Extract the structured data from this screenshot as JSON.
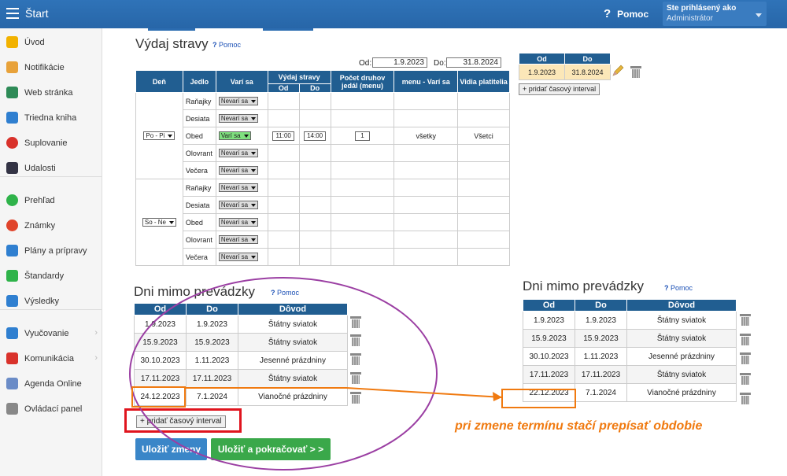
{
  "topbar": {
    "title": "Štart",
    "help": "Pomoc",
    "user_line1": "Ste prihlásený ako",
    "user_line2": "Administrátor"
  },
  "sidebar": {
    "items": [
      {
        "label": "Úvod",
        "icon": "star-icon",
        "color": "#f2b200"
      },
      {
        "label": "Notifikácie",
        "icon": "envelope-icon",
        "color": "#e8a23a"
      },
      {
        "label": "Web stránka",
        "icon": "home-icon",
        "color": "#2e8b57"
      },
      {
        "label": "Triedna kniha",
        "icon": "book-icon",
        "color": "#2f7fd0"
      },
      {
        "label": "Suplovanie",
        "icon": "person-icon",
        "color": "#d9322b"
      },
      {
        "label": "Udalosti",
        "icon": "calendar-icon",
        "color": "#334"
      },
      {
        "label": "Prehľad",
        "icon": "check-circle-icon",
        "color": "#2fb34a"
      },
      {
        "label": "Známky",
        "icon": "grade-icon",
        "color": "#e0442b"
      },
      {
        "label": "Plány a prípravy",
        "icon": "briefcase-icon",
        "color": "#2f7fd0"
      },
      {
        "label": "Štandardy",
        "icon": "shield-icon",
        "color": "#2fb34a"
      },
      {
        "label": "Výsledky",
        "icon": "bar-chart-icon",
        "color": "#2f7fd0"
      },
      {
        "label": "Vyučovanie",
        "icon": "book-open-icon",
        "color": "#2f7fd0"
      },
      {
        "label": "Komunikácia",
        "icon": "chat-icon",
        "color": "#d9322b"
      },
      {
        "label": "Agenda Online",
        "icon": "pen-icon",
        "color": "#6b8cc7"
      },
      {
        "label": "Ovládací panel",
        "icon": "gear-icon",
        "color": "#888"
      }
    ]
  },
  "vydaj": {
    "title": "Výdaj stravy",
    "help": "Pomoc",
    "od_label": "Od:",
    "od_value": "1.9.2023",
    "do_label": "Do:",
    "do_value": "31.8.2024",
    "headers": {
      "den": "Deň",
      "jedlo": "Jedlo",
      "vari": "Varí sa",
      "vydaj": "Výdaj stravy",
      "od": "Od",
      "do": "Do",
      "pocet": "Počet druhov jedál (menu)",
      "menu": "menu - Varí sa",
      "vidia": "Vidia platitelia"
    },
    "group1": {
      "day": "Po - Pi",
      "meals": [
        {
          "name": "Raňajky",
          "status": "Nevarí sa"
        },
        {
          "name": "Desiata",
          "status": "Nevarí sa"
        },
        {
          "name": "Obed",
          "status": "Varí sa",
          "od": "11:00",
          "do": "14:00",
          "pocet": "1",
          "menu": "všetky",
          "vidia": "Všetci"
        },
        {
          "name": "Olovrant",
          "status": "Nevarí sa"
        },
        {
          "name": "Večera",
          "status": "Nevarí sa"
        }
      ]
    },
    "group2": {
      "day": "So - Ne",
      "meals": [
        {
          "name": "Raňajky",
          "status": "Nevarí sa"
        },
        {
          "name": "Desiata",
          "status": "Nevarí sa"
        },
        {
          "name": "Obed",
          "status": "Nevarí sa"
        },
        {
          "name": "Olovrant",
          "status": "Nevarí sa"
        },
        {
          "name": "Večera",
          "status": "Nevarí sa"
        }
      ]
    }
  },
  "interval": {
    "od_header": "Od",
    "do_header": "Do",
    "od": "1.9.2023",
    "do": "31.8.2024",
    "add": "+ pridať časový interval"
  },
  "dni_left": {
    "title": "Dni mimo prevádzky",
    "help": "Pomoc",
    "headers": [
      "Od",
      "Do",
      "Dôvod"
    ],
    "rows": [
      [
        "1.9.2023",
        "1.9.2023",
        "Štátny sviatok"
      ],
      [
        "15.9.2023",
        "15.9.2023",
        "Štátny sviatok"
      ],
      [
        "30.10.2023",
        "1.11.2023",
        "Jesenné prázdniny"
      ],
      [
        "17.11.2023",
        "17.11.2023",
        "Štátny sviatok"
      ],
      [
        "24.12.2023",
        "7.1.2024",
        "Vianočné prázdniny"
      ]
    ],
    "add": "+ pridať časový interval",
    "save": "Uložiť zmeny",
    "save_continue": "Uložiť a pokračovať > >"
  },
  "dni_right": {
    "title": "Dni mimo prevádzky",
    "help": "Pomoc",
    "headers": [
      "Od",
      "Do",
      "Dôvod"
    ],
    "rows": [
      [
        "1.9.2023",
        "1.9.2023",
        "Štátny sviatok"
      ],
      [
        "15.9.2023",
        "15.9.2023",
        "Štátny sviatok"
      ],
      [
        "30.10.2023",
        "1.11.2023",
        "Jesenné prázdniny"
      ],
      [
        "17.11.2023",
        "17.11.2023",
        "Štátny sviatok"
      ],
      [
        "22.12.2023",
        "7.1.2024",
        "Vianočné prázdniny"
      ]
    ]
  },
  "annotation": "pri zmene termínu stačí prepísať obdobie",
  "colors": {
    "header": "#215e91",
    "topbar": "#2b6cb0",
    "annotation": "#f07a10",
    "circle": "#9b3fa3",
    "red_box": "#e0141e",
    "save_blue": "#3a86c8",
    "save_green": "#3aa84a"
  }
}
